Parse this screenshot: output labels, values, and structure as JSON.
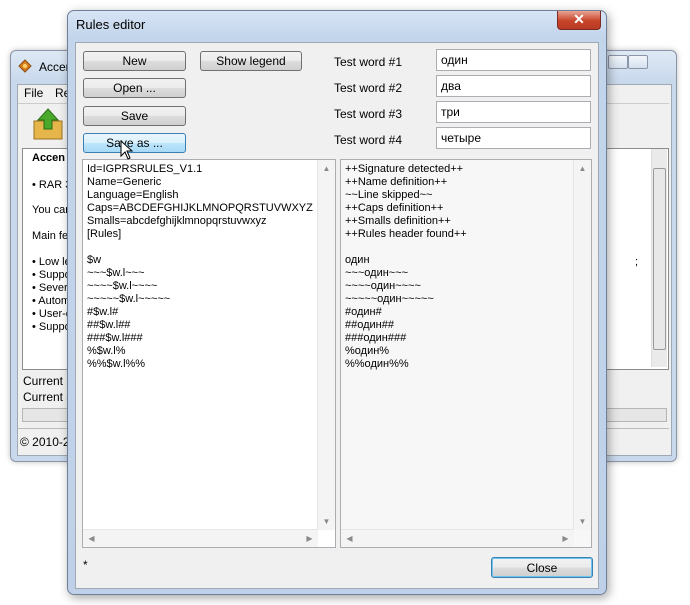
{
  "background_window": {
    "title": "Accen",
    "menu": [
      "File",
      "Re"
    ],
    "text_lines": [
      "Accen",
      "• RAR 3",
      "You can",
      "Main fea",
      "• Low le",
      "• Suppo",
      "• Sever",
      "• Autom",
      "• User-d",
      "• Suppo"
    ],
    "text_right": ";",
    "status_current_1": "Current p",
    "status_current_2": "Current s",
    "copyright": "© 2010-2"
  },
  "dialog": {
    "title": "Rules editor",
    "close_glyph": "✕",
    "buttons": {
      "new": "New",
      "open": "Open ...",
      "save": "Save",
      "save_as": "Save as ...",
      "show_legend": "Show legend",
      "close": "Close"
    },
    "test_words": [
      {
        "label": "Test word #1",
        "value": "один"
      },
      {
        "label": "Test word #2",
        "value": "два"
      },
      {
        "label": "Test word #3",
        "value": "три"
      },
      {
        "label": "Test word #4",
        "value": "четыре"
      }
    ],
    "rules_text": "Id=IGPRSRULES_V1.1\nName=Generic\nLanguage=English\nCaps=ABCDEFGHIJKLMNOPQRSTUVWXYZ\nSmalls=abcdefghijklmnopqrstuvwxyz\n[Rules]\n\n$w\n~~~$w.l~~~\n~~~~$w.l~~~~\n~~~~~$w.l~~~~~\n#$w.l#\n##$w.l##\n###$w.l###\n%$w.l%\n%%$w.l%%",
    "output_text": "++Signature detected++\n++Name definition++\n~~Line skipped~~\n++Caps definition++\n++Smalls definition++\n++Rules header found++\n\nодин\n~~~один~~~\n~~~~один~~~~\n~~~~~один~~~~~\n#один#\n##один##\n###один###\n%один%\n%%один%%",
    "status": "*"
  }
}
